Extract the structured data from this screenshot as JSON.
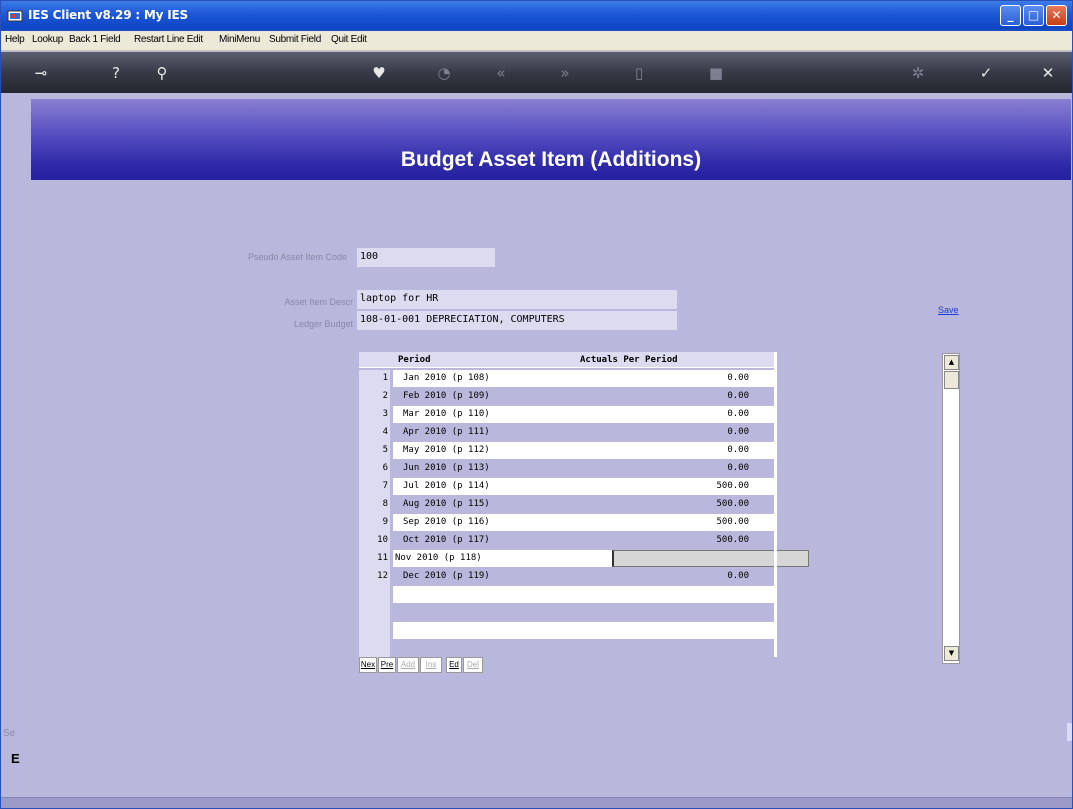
{
  "window": {
    "title": "IES Client v8.29 : My IES",
    "min_glyph": "_",
    "max_glyph": "□",
    "close_glyph": "✕"
  },
  "menu": [
    "Help",
    "Lookup",
    "Back 1 Field",
    "Restart Line Edit",
    "MiniMenu",
    "Submit Field",
    "Quit Edit"
  ],
  "toolbar": {
    "icons": [
      "key-icon",
      "help-icon",
      "search-icon",
      "heart-icon",
      "clock-icon",
      "rewind-icon",
      "forward-icon",
      "document-icon",
      "stop-icon",
      "gear-icon",
      "check-icon",
      "close-icon"
    ],
    "glyphs": [
      "⊸",
      "?",
      "⚲",
      "♥",
      "◔",
      "«",
      "»",
      "▯",
      "■",
      "✲",
      "✓",
      "✕"
    ]
  },
  "page": {
    "title": "Budget Asset Item (Additions)"
  },
  "form": {
    "pseudo_code_label": "Pseudo Asset Item Code",
    "pseudo_code_value": "100",
    "descr_label": "Asset Item Descr",
    "descr_value": "laptop for HR",
    "ledger_label": "Ledger Budget",
    "ledger_value": "108-01-001 DEPRECIATION, COMPUTERS",
    "save_label": "Save"
  },
  "grid": {
    "col_period": "Period",
    "col_actuals": "Actuals Per Period",
    "rows": [
      {
        "num": "1",
        "period": "Jan 2010 (p 108)",
        "amount": "0.00"
      },
      {
        "num": "2",
        "period": "Feb 2010 (p 109)",
        "amount": "0.00"
      },
      {
        "num": "3",
        "period": "Mar 2010 (p 110)",
        "amount": "0.00"
      },
      {
        "num": "4",
        "period": "Apr 2010 (p 111)",
        "amount": "0.00"
      },
      {
        "num": "5",
        "period": "May 2010 (p 112)",
        "amount": "0.00"
      },
      {
        "num": "6",
        "period": "Jun 2010 (p 113)",
        "amount": "0.00"
      },
      {
        "num": "7",
        "period": "Jul 2010 (p 114)",
        "amount": "500.00"
      },
      {
        "num": "8",
        "period": "Aug 2010 (p 115)",
        "amount": "500.00"
      },
      {
        "num": "9",
        "period": "Sep 2010 (p 116)",
        "amount": "500.00"
      },
      {
        "num": "10",
        "period": "Oct 2010 (p 117)",
        "amount": "500.00"
      },
      {
        "num": "11",
        "period": "Nov 2010 (p 118)",
        "amount": ""
      },
      {
        "num": "12",
        "period": "Dec 2010 (p 119)",
        "amount": "0.00"
      }
    ]
  },
  "nav_buttons": [
    "Nex",
    "Pre",
    "Add",
    "Ins",
    "Ed",
    "Del"
  ],
  "scroll": {
    "up": "▲",
    "down": "▼"
  },
  "side": {
    "se": "Se",
    "e": "E"
  }
}
